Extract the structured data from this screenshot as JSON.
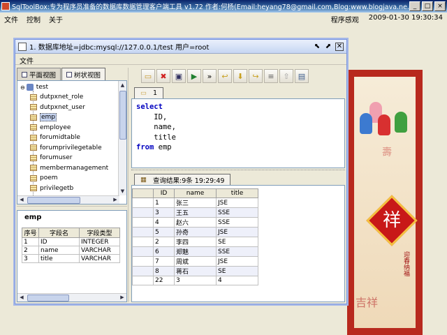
{
  "app": {
    "title": "SqlToolBox:专为程序员准备的数据库数据管理客户端工具 v1.72 作者:何杨(Email:heyang78@gmail.com,Blog:www.blogjava.ne...",
    "menu": [
      "文件",
      "控制",
      "关于"
    ],
    "status_label": "程序感观",
    "datetime": "2009-01-30 19:30:34"
  },
  "window": {
    "title": "1. 数据库地址=jdbc:mysql://127.0.0.1/test 用户=root",
    "menu": [
      "文件"
    ],
    "ctrl_labels": [
      "⬉",
      "⬈",
      "✕"
    ]
  },
  "left_tabs": [
    "平面视图",
    "树状视图"
  ],
  "tree": {
    "root": "test",
    "items": [
      "dutpxnet_role",
      "dutpxnet_user",
      "emp",
      "employee",
      "forumidtable",
      "forumprivilegetable",
      "forumuser",
      "membermanagement",
      "poem",
      "privilegetb"
    ],
    "selected": "emp"
  },
  "fields": {
    "table_name": "emp",
    "headers": [
      "序号",
      "字段名",
      "字段类型"
    ],
    "rows": [
      [
        "1",
        "ID",
        "INTEGER"
      ],
      [
        "2",
        "name",
        "VARCHAR"
      ],
      [
        "3",
        "title",
        "VARCHAR"
      ]
    ]
  },
  "toolbar_icons": [
    "folder-open-icon",
    "delete-icon",
    "save-icon",
    "run-icon",
    "run-all-icon",
    "undo-icon",
    "down-arrow-icon",
    "redo-icon",
    "align-icon",
    "up-arrow-icon",
    "window-icon"
  ],
  "editor": {
    "tab_label": "1",
    "lines": [
      {
        "kw": "select",
        "text": ""
      },
      {
        "kw": "",
        "text": "    ID,"
      },
      {
        "kw": "",
        "text": "    name,"
      },
      {
        "kw": "",
        "text": "    title"
      },
      {
        "kw": "from",
        "text": " emp"
      }
    ]
  },
  "results": {
    "tab_label": "查询结果:9条 19:29:49",
    "headers": [
      "",
      "ID",
      "name",
      "title"
    ],
    "rows": [
      [
        "",
        "1",
        "张三",
        "JSE"
      ],
      [
        "",
        "3",
        "王五",
        "SSE"
      ],
      [
        "",
        "4",
        "赵六",
        "SSE"
      ],
      [
        "",
        "5",
        "孙奇",
        "JSE"
      ],
      [
        "",
        "2",
        "李四",
        "SE"
      ],
      [
        "",
        "6",
        "郑魅",
        "SSE"
      ],
      [
        "",
        "7",
        "周斌",
        "JSE"
      ],
      [
        "",
        "8",
        "蒋石",
        "SE"
      ],
      [
        "",
        "22",
        "3",
        "4"
      ]
    ]
  },
  "background": {
    "fu_char": "祥",
    "vertical_text": "迎春纳福",
    "bottom_text": "吉祥"
  }
}
